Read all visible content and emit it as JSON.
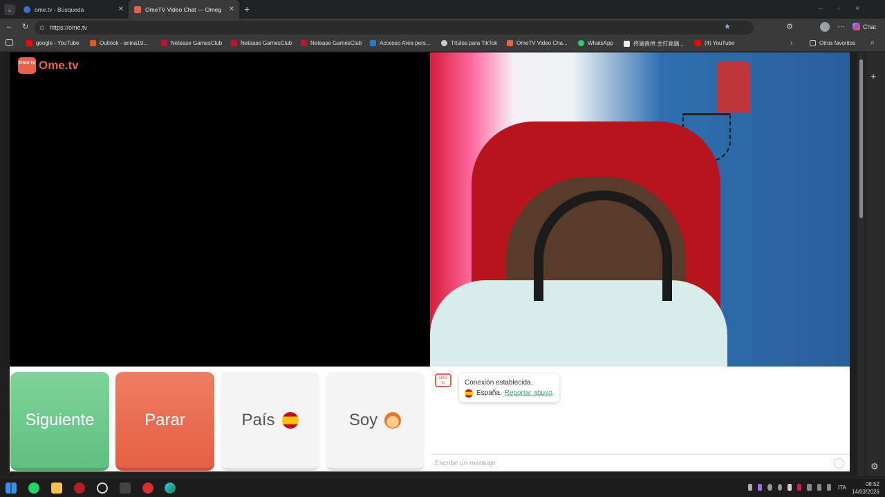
{
  "browser": {
    "tabs": [
      {
        "label": "ome.tv - Búsqueda",
        "color": "#3b6fd6"
      },
      {
        "label": "OmeTV Video Chat — Omegl",
        "color": "#e9604f"
      }
    ],
    "url": "https://ome.tv",
    "chat_button": "Chat"
  },
  "bookmarks": [
    {
      "label": "google - YouTube",
      "color": "#ff0000"
    },
    {
      "label": "Outlook - anina19...",
      "color": "#f25022"
    },
    {
      "label": "Netease GamesClub",
      "color": "#c4122f"
    },
    {
      "label": "Netease GamesClub",
      "color": "#c4122f"
    },
    {
      "label": "Netease GamesClub",
      "color": "#c4122f"
    },
    {
      "label": "Accesso Area pers...",
      "color": "#2a7ac6"
    },
    {
      "label": "Títulos para TikTok",
      "color": "#cccccc"
    },
    {
      "label": "OmeTV Video Cha...",
      "color": "#e9604f"
    },
    {
      "label": "WhatsApp",
      "color": "#25d366"
    },
    {
      "label": "终端直供 主打高端...",
      "color": "#eeeeee"
    },
    {
      "label": "(4) YouTube",
      "color": "#ff0000"
    }
  ],
  "other_favorites": "Otros favoritos",
  "site": {
    "logo_badge": "Ome tv",
    "logo_text": "Ome.tv"
  },
  "controls": {
    "next": "Siguiente",
    "stop": "Parar",
    "country": "País",
    "gender": "Soy"
  },
  "chat": {
    "status": "Conexión establecida.",
    "country": "España.",
    "report": "Reportar abuso",
    "report_suffix": ".",
    "placeholder": "Escribe un mensaje"
  },
  "taskbar": {
    "lang": "ITA",
    "time": "08:52",
    "date": "14/03/2026"
  }
}
